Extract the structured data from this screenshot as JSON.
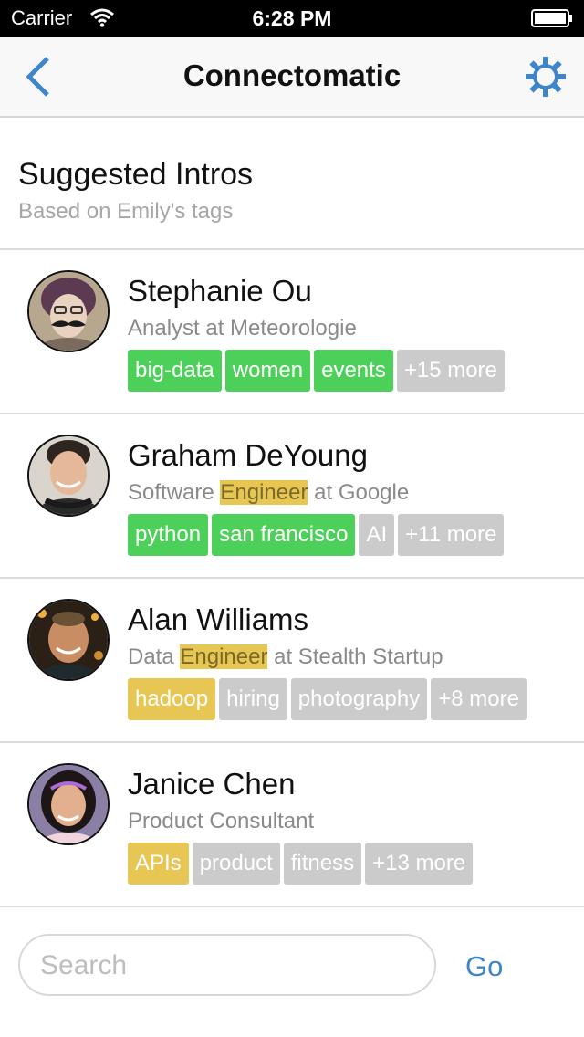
{
  "status_bar": {
    "carrier": "Carrier",
    "time": "6:28 PM"
  },
  "nav": {
    "title": "Connectomatic"
  },
  "header": {
    "title": "Suggested Intros",
    "subtitle": "Based on Emily's tags"
  },
  "colors": {
    "accent": "#3e86c9",
    "tag_green": "#4cd05a",
    "tag_yellow": "#e8c654",
    "tag_gray": "#cbcbcb"
  },
  "contacts": [
    {
      "name": "Stephanie Ou",
      "title_parts": [
        "Analyst at Meteorologie"
      ],
      "tags": [
        {
          "label": "big-data",
          "color": "green"
        },
        {
          "label": "women",
          "color": "green"
        },
        {
          "label": "events",
          "color": "green"
        },
        {
          "label": "+15 more",
          "color": "gray"
        }
      ]
    },
    {
      "name": "Graham DeYoung",
      "title_parts": [
        "Software ",
        "Engineer",
        " at Google"
      ],
      "tags": [
        {
          "label": "python",
          "color": "green"
        },
        {
          "label": "san francisco",
          "color": "green"
        },
        {
          "label": "AI",
          "color": "gray"
        },
        {
          "label": "+11 more",
          "color": "gray"
        }
      ]
    },
    {
      "name": "Alan Williams",
      "title_parts": [
        "Data ",
        "Engineer",
        " at Stealth Startup"
      ],
      "tags": [
        {
          "label": "hadoop",
          "color": "yellow"
        },
        {
          "label": "hiring",
          "color": "gray"
        },
        {
          "label": "photography",
          "color": "gray"
        },
        {
          "label": "+8 more",
          "color": "gray"
        }
      ]
    },
    {
      "name": "Janice Chen",
      "title_parts": [
        "Product Consultant"
      ],
      "tags": [
        {
          "label": "APIs",
          "color": "yellow"
        },
        {
          "label": "product",
          "color": "gray"
        },
        {
          "label": "fitness",
          "color": "gray"
        },
        {
          "label": "+13 more",
          "color": "gray"
        }
      ]
    }
  ],
  "search": {
    "placeholder": "Search",
    "value": "",
    "go_label": "Go"
  }
}
